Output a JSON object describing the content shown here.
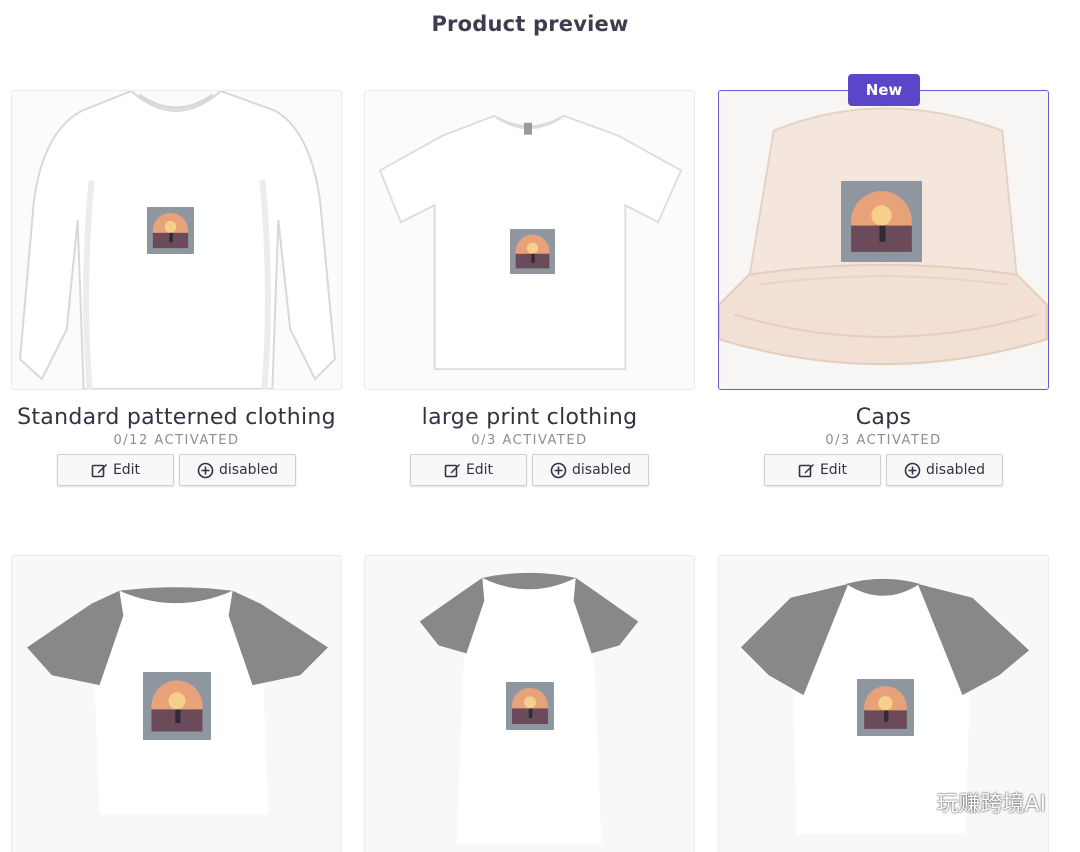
{
  "header": {
    "title": "Product preview"
  },
  "products": [
    {
      "title": "Standard patterned clothing",
      "status": "0/12 ACTIVATED",
      "edit_label": "Edit",
      "toggle_label": "disabled",
      "badge": ""
    },
    {
      "title": "large print clothing",
      "status": "0/3 ACTIVATED",
      "edit_label": "Edit",
      "toggle_label": "disabled",
      "badge": ""
    },
    {
      "title": "Caps",
      "status": "0/3 ACTIVATED",
      "edit_label": "Edit",
      "toggle_label": "disabled",
      "badge": "New"
    }
  ],
  "watermark": {
    "text": "玩赚跨境AI",
    "icon": "wechat-icon"
  },
  "colors": {
    "accent": "#5b46c9",
    "selected_border": "#6a5acd",
    "garment_gray": "#8a8a8a"
  }
}
